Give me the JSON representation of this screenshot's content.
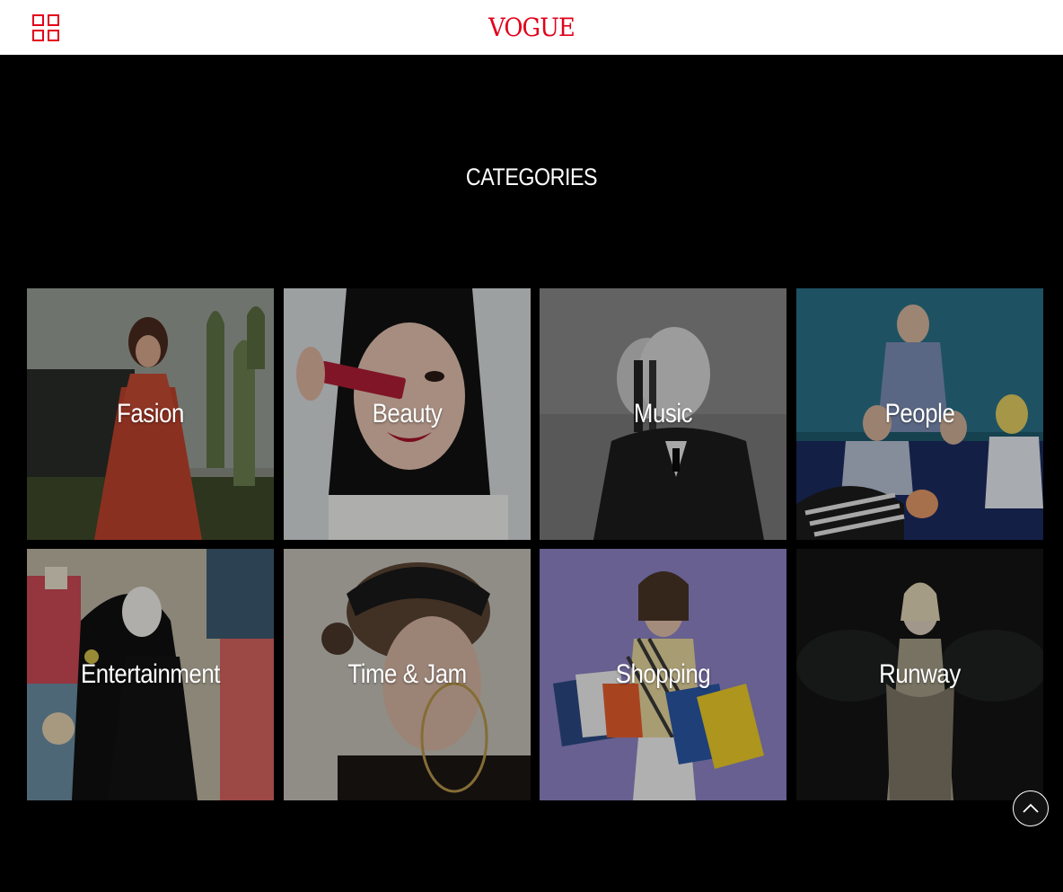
{
  "header": {
    "menu_icon": "grid-menu-icon",
    "logo_text": "VOGUE",
    "logo_color": "#e3001b",
    "background": "#ffffff"
  },
  "main": {
    "section_title": "CATEGORIES",
    "categories": [
      {
        "label": "Fasion"
      },
      {
        "label": "Beauty"
      },
      {
        "label": "Music"
      },
      {
        "label": "People"
      },
      {
        "label": "Entertainment"
      },
      {
        "label": "Time & Jam"
      },
      {
        "label": "Shopping"
      },
      {
        "label": "Runway"
      }
    ]
  },
  "scroll_top_icon": "chevron-up-icon"
}
